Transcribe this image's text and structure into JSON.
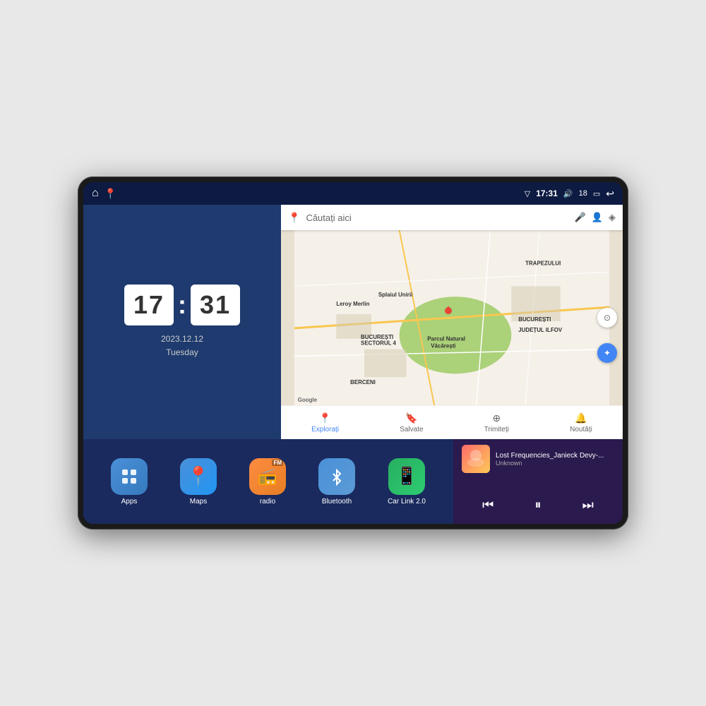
{
  "device": {
    "screen_bg": "#1a2a5e"
  },
  "status_bar": {
    "time": "17:31",
    "battery_level": "18",
    "signal_icon": "▽",
    "volume_icon": "🔊",
    "battery_icon": "🔋",
    "back_icon": "↩"
  },
  "clock": {
    "hour": "17",
    "minute": "31",
    "date": "2023.12.12",
    "day": "Tuesday"
  },
  "map": {
    "search_placeholder": "Căutați aici",
    "bottom_nav": [
      {
        "label": "Explorați",
        "icon": "📍",
        "active": true
      },
      {
        "label": "Salvate",
        "icon": "🔖",
        "active": false
      },
      {
        "label": "Trimiteți",
        "icon": "⊕",
        "active": false
      },
      {
        "label": "Noutăți",
        "icon": "🔔",
        "active": false
      }
    ],
    "labels": {
      "trapezului": "TRAPEZULUI",
      "bucuresti": "BUCUREȘTI",
      "judet": "JUDEȚUL ILFOV",
      "berceni": "BERCENI",
      "sector4": "BUCUREȘTI\nSECTORUL 4",
      "leroy": "Leroy Merlin",
      "parcul": "Parcul Natural Văcărești",
      "splaiul": "Splaiul Unirii"
    }
  },
  "apps": [
    {
      "id": "apps",
      "label": "Apps",
      "icon": "⊞",
      "icon_class": "icon-apps"
    },
    {
      "id": "maps",
      "label": "Maps",
      "icon": "📍",
      "icon_class": "icon-maps"
    },
    {
      "id": "radio",
      "label": "radio",
      "icon": "📻",
      "icon_class": "icon-radio",
      "badge": "FM"
    },
    {
      "id": "bluetooth",
      "label": "Bluetooth",
      "icon": "⬡",
      "icon_class": "icon-bluetooth"
    },
    {
      "id": "carlink",
      "label": "Car Link 2.0",
      "icon": "📱",
      "icon_class": "icon-carlink"
    }
  ],
  "music": {
    "title": "Lost Frequencies_Janieck Devy-...",
    "artist": "Unknown",
    "prev_label": "⏮",
    "play_label": "⏸",
    "next_label": "⏭"
  }
}
